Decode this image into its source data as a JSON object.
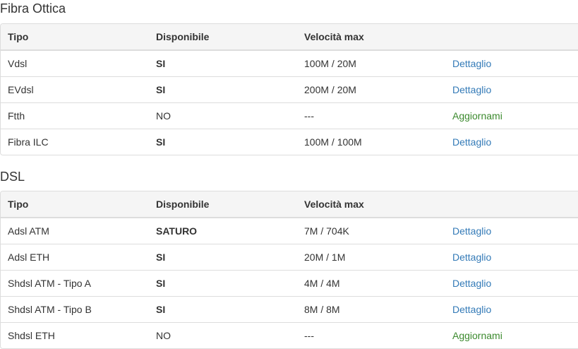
{
  "sections": [
    {
      "title": "Fibra Ottica",
      "headers": [
        "Tipo",
        "Disponibile",
        "Velocità max",
        ""
      ],
      "rows": [
        {
          "tipo": "Vdsl",
          "disponibile": "SI",
          "velocita": "100M / 20M",
          "azione": "Dettaglio",
          "azione_type": "detail",
          "bold": true
        },
        {
          "tipo": "EVdsl",
          "disponibile": "SI",
          "velocita": "200M / 20M",
          "azione": "Dettaglio",
          "azione_type": "detail",
          "bold": true
        },
        {
          "tipo": "Ftth",
          "disponibile": "NO",
          "velocita": "---",
          "azione": "Aggiornami",
          "azione_type": "update",
          "bold": false
        },
        {
          "tipo": "Fibra ILC",
          "disponibile": "SI",
          "velocita": "100M / 100M",
          "azione": "Dettaglio",
          "azione_type": "detail",
          "bold": true
        }
      ]
    },
    {
      "title": "DSL",
      "headers": [
        "Tipo",
        "Disponibile",
        "Velocità max",
        ""
      ],
      "rows": [
        {
          "tipo": "Adsl ATM",
          "disponibile": "SATURO",
          "velocita": "7M / 704K",
          "azione": "Dettaglio",
          "azione_type": "detail",
          "bold": true
        },
        {
          "tipo": "Adsl ETH",
          "disponibile": "SI",
          "velocita": "20M / 1M",
          "azione": "Dettaglio",
          "azione_type": "detail",
          "bold": true
        },
        {
          "tipo": "Shdsl ATM - Tipo A",
          "disponibile": "SI",
          "velocita": "4M / 4M",
          "azione": "Dettaglio",
          "azione_type": "detail",
          "bold": true
        },
        {
          "tipo": "Shdsl ATM - Tipo B",
          "disponibile": "SI",
          "velocita": "8M / 8M",
          "azione": "Dettaglio",
          "azione_type": "detail",
          "bold": true
        },
        {
          "tipo": "Shdsl ETH",
          "disponibile": "NO",
          "velocita": "---",
          "azione": "Aggiornami",
          "azione_type": "update",
          "bold": false
        }
      ]
    }
  ],
  "colors": {
    "link_detail": "#337ab7",
    "link_update": "#3c8a2e",
    "header_bg": "#f5f5f5",
    "border": "#dddddd"
  }
}
